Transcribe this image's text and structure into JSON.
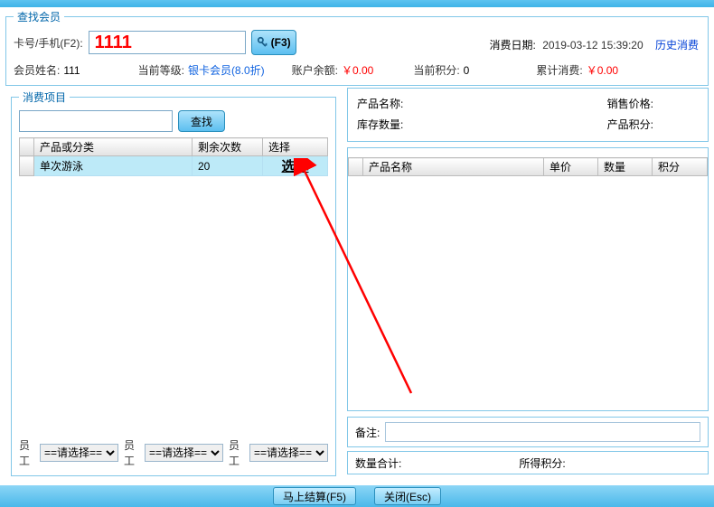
{
  "top": {
    "find_member_legend": "查找会员",
    "card_label": "卡号/手机(F2):",
    "card_value": "1111",
    "f3_label": "(F3)",
    "consume_date_label": "消费日期:",
    "consume_date_value": "2019-03-12 15:39:20",
    "history_link": "历史消费",
    "name_label": "会员姓名:",
    "name_value": "111",
    "level_label": "当前等级:",
    "level_value": "银卡会员(8.0折)",
    "balance_label": "账户余额:",
    "balance_value": "￥0.00",
    "points_label": "当前积分:",
    "points_value": "0",
    "total_label": "累计消费:",
    "total_value": "￥0.00"
  },
  "left": {
    "legend": "消费项目",
    "search_btn": "查找",
    "col_product": "产品或分类",
    "col_remain": "剩余次数",
    "col_select": "选择",
    "rows": {
      "r0": {
        "name": "单次游泳",
        "remain": "20",
        "select": "选择"
      }
    },
    "emp_label": "员工",
    "emp_placeholder": "==请选择=="
  },
  "right": {
    "product_name_label": "产品名称:",
    "sale_price_label": "销售价格:",
    "stock_label": "库存数量:",
    "product_points_label": "产品积分:",
    "col_product": "产品名称",
    "col_price": "单价",
    "col_qty": "数量",
    "col_points": "积分",
    "remark_label": "备注:",
    "qty_total_label": "数量合计:",
    "points_gain_label": "所得积分:"
  },
  "bottom": {
    "checkout": "马上结算(F5)",
    "close": "关闭(Esc)"
  }
}
